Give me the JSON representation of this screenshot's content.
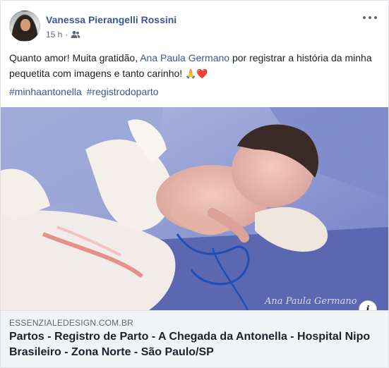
{
  "post": {
    "author": "Vanessa Pierangelli Rossini",
    "time": "15 h",
    "separator": "·",
    "privacy_icon": "friends-icon",
    "more_icon": "more-options-icon",
    "text_before": "Quanto amor! Muita gratidão, ",
    "mention": "Ana Paula Germano",
    "text_after": " por registrar a história da minha pequetita com imagens e tanto carinho! ",
    "emojis": "🙏❤️",
    "hashtags": [
      "#minhaantonella",
      "#registrodoparto"
    ]
  },
  "photo": {
    "watermark": "Ana Paula Germano"
  },
  "link": {
    "domain": "ESSENZIALEDESIGN.COM.BR",
    "title": "Partos - Registro de Parto - A Chegada da Antonella - Hospital Nipo Brasileiro - Zona Norte - São Paulo/SP",
    "info_icon": "info-icon",
    "info_label": "i"
  },
  "colors": {
    "link_blue": "#385898",
    "text": "#1c1e21",
    "meta": "#606770",
    "link_box_bg": "#f2f3f5"
  }
}
